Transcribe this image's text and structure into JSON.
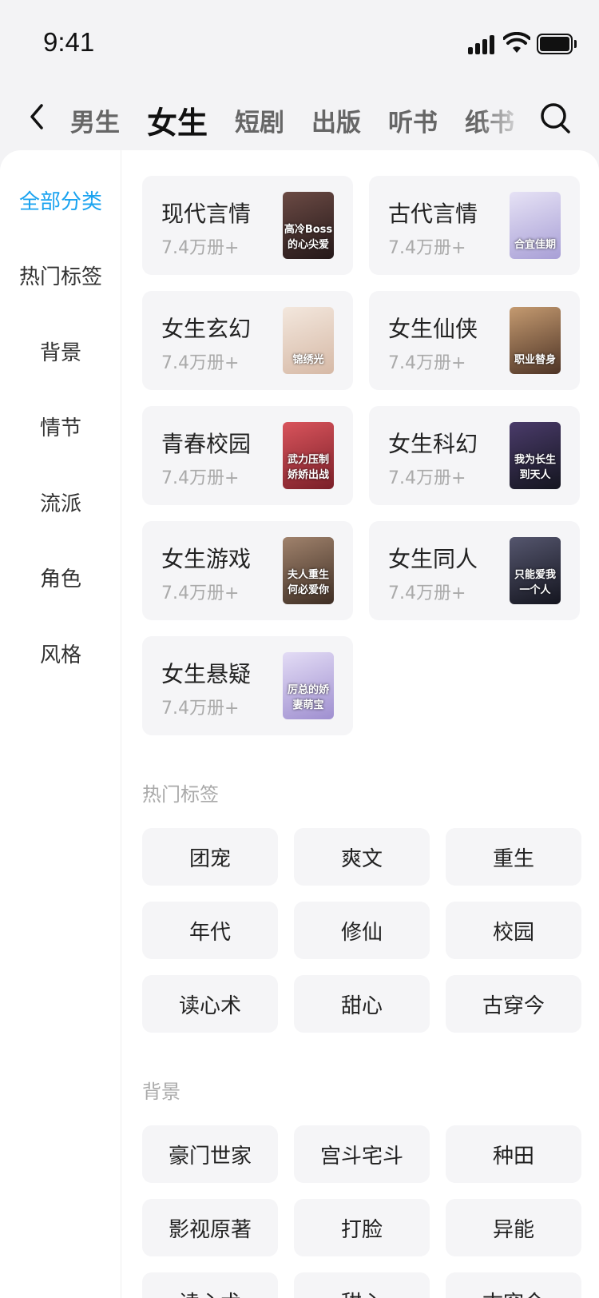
{
  "status_bar": {
    "time": "9:41"
  },
  "nav": {
    "tabs": [
      {
        "label": "男生"
      },
      {
        "label": "女生",
        "active": true
      },
      {
        "label": "短剧"
      },
      {
        "label": "出版"
      },
      {
        "label": "听书"
      },
      {
        "label": "纸书"
      }
    ]
  },
  "sidebar": {
    "items": [
      {
        "label": "全部分类",
        "active": true
      },
      {
        "label": "热门标签"
      },
      {
        "label": "背景"
      },
      {
        "label": "情节"
      },
      {
        "label": "流派"
      },
      {
        "label": "角色"
      },
      {
        "label": "风格"
      }
    ]
  },
  "categories": [
    {
      "name": "现代言情",
      "count": "7.4万册+",
      "cover_title": "高冷Boss的心尖爱",
      "cover_color": "#3a2a2c"
    },
    {
      "name": "古代言情",
      "count": "7.4万册+",
      "cover_title": "合宜佳期",
      "cover_color": "#c9c3e6"
    },
    {
      "name": "女生玄幻",
      "count": "7.4万册+",
      "cover_title": "锦绣光",
      "cover_color": "#e9d9cf"
    },
    {
      "name": "女生仙侠",
      "count": "7.4万册+",
      "cover_title": "职业替身",
      "cover_color": "#8a6a55"
    },
    {
      "name": "青春校园",
      "count": "7.4万册+",
      "cover_title": "武力压制娇娇出战",
      "cover_color": "#b8363e"
    },
    {
      "name": "女生科幻",
      "count": "7.4万册+",
      "cover_title": "我为长生到天人",
      "cover_color": "#24253a"
    },
    {
      "name": "女生游戏",
      "count": "7.4万册+",
      "cover_title": "夫人重生何必爱你",
      "cover_color": "#7c6656"
    },
    {
      "name": "女生同人",
      "count": "7.4万册+",
      "cover_title": "只能爱我一个人",
      "cover_color": "#27283a"
    },
    {
      "name": "女生悬疑",
      "count": "7.4万册+",
      "cover_title": "厉总的娇妻萌宝",
      "cover_color": "#c8bde6"
    }
  ],
  "hot_tags": {
    "title": "热门标签",
    "tags": [
      "团宠",
      "爽文",
      "重生",
      "年代",
      "修仙",
      "校园",
      "读心术",
      "甜心",
      "古穿今"
    ]
  },
  "background": {
    "title": "背景",
    "tags": [
      "豪门世家",
      "宫斗宅斗",
      "种田",
      "影视原著",
      "打脸",
      "异能",
      "读心术",
      "甜心",
      "古穿今"
    ]
  },
  "colors": {
    "accent": "#1aa3f0"
  },
  "icons": {
    "back": "chevron-left-icon",
    "search": "search-icon"
  }
}
